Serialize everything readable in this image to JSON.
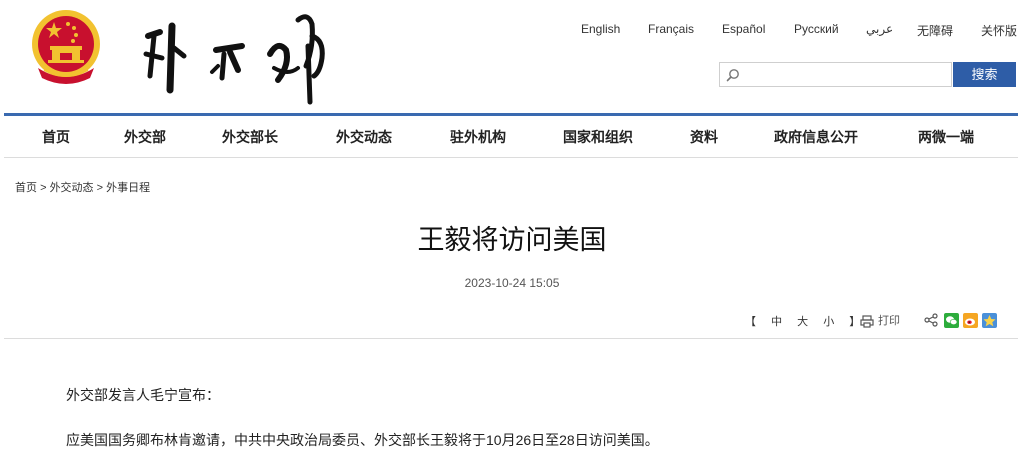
{
  "header": {
    "languages": [
      "English",
      "Français",
      "Español",
      "Русский",
      "عربي",
      "无障碍",
      "关怀版"
    ],
    "search": {
      "placeholder": "",
      "button_label": "搜索"
    }
  },
  "nav": {
    "items": [
      "首页",
      "外交部",
      "外交部长",
      "外交动态",
      "驻外机构",
      "国家和组织",
      "资料",
      "政府信息公开",
      "两微一端"
    ]
  },
  "breadcrumb": {
    "items": [
      "首页",
      "外交动态",
      "外事日程"
    ],
    "separator": ">"
  },
  "article": {
    "title": "王毅将访问美国",
    "datetime": "2023-10-24 15:05",
    "font_size": {
      "open": "【",
      "large": "中",
      "medium": "大",
      "small": "小",
      "close": "】"
    },
    "print_label": "打印",
    "share_icons": [
      "share-icon",
      "wechat-icon",
      "weibo-icon",
      "qzone-icon"
    ],
    "paragraphs": [
      "外交部发言人毛宁宣布：",
      "应美国国务卿布林肯邀请，中共中央政治局委员、外交部长王毅将于10月26日至28日访问美国。"
    ]
  },
  "colors": {
    "accent": "#2e5da7",
    "rule": "#3a6ab0",
    "emblem_red": "#c8102e",
    "emblem_gold": "#f2c230"
  }
}
